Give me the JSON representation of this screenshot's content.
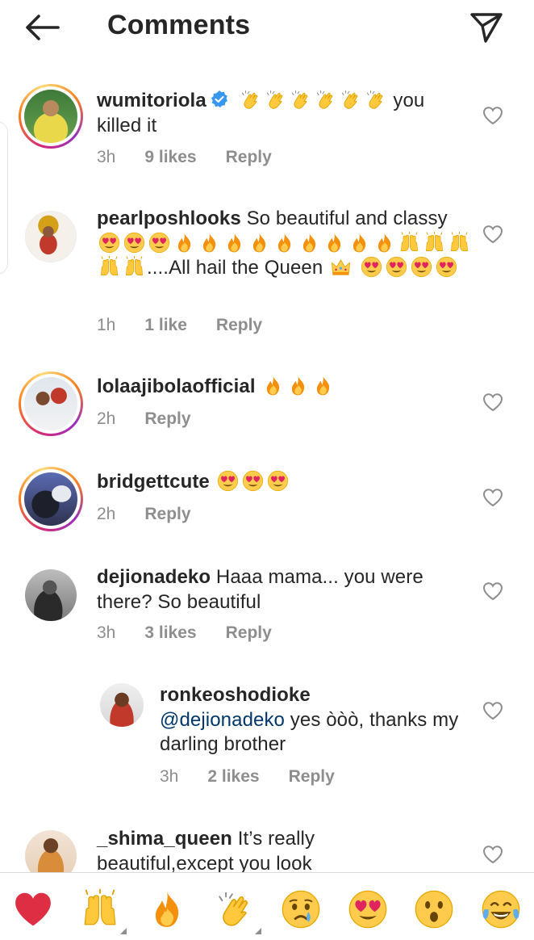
{
  "header": {
    "title": "Comments",
    "back_icon": "arrow-left-icon",
    "share_icon": "paper-plane-icon"
  },
  "comments": [
    {
      "username": "wumitoriola",
      "verified": true,
      "text": "you killed it",
      "emojis": [
        "clapping-hands",
        "clapping-hands",
        "clapping-hands",
        "clapping-hands",
        "clapping-hands",
        "clapping-hands"
      ],
      "time": "3h",
      "likes": "9 likes",
      "reply": "Reply"
    },
    {
      "username": "pearlposhlooks",
      "text_a": "So beautiful and classy",
      "text_b": "....All hail the Queen",
      "time": "1h",
      "likes": "1 like",
      "reply": "Reply"
    },
    {
      "username": "lolaajibolaofficial",
      "time": "2h",
      "reply": "Reply"
    },
    {
      "username": "bridgettcute",
      "time": "2h",
      "reply": "Reply"
    },
    {
      "username": "dejionadeko",
      "text": "Haaa mama... you were there? So beautiful",
      "time": "3h",
      "likes": "3 likes",
      "reply": "Reply"
    },
    {
      "username": "ronkeoshodioke",
      "mention": "@dejionadeko",
      "text": "yes òòò, thanks my darling brother",
      "time": "3h",
      "likes": "2 likes",
      "reply": "Reply"
    },
    {
      "username": "_shima_queen",
      "text": "It’s really beautiful,except you look"
    }
  ],
  "quick_reactions": [
    "red-heart",
    "raising-hands",
    "fire",
    "clapping-hands",
    "crying-face",
    "heart-eyes",
    "surprised-face",
    "tears-of-joy"
  ],
  "colors": {
    "text": "#262626",
    "muted": "#8e8e8e",
    "mention": "#00376b",
    "verified": "#3897f0",
    "story_ring_a": "#d62976",
    "story_ring_b": "#fa7e1e"
  }
}
